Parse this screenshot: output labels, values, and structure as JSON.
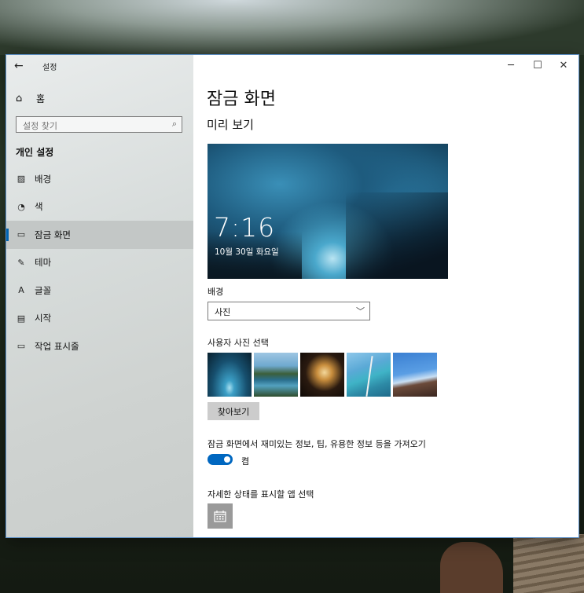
{
  "window": {
    "title": "설정",
    "back_icon": "←",
    "minimize_icon": "─",
    "maximize_icon": "☐",
    "close_icon": "✕"
  },
  "sidebar": {
    "home_icon": "⌂",
    "home_label": "홈",
    "search_placeholder": "설정 찾기",
    "search_icon": "⌕",
    "section_title": "개인 설정",
    "items": [
      {
        "icon": "🖼",
        "icon_name": "picture-icon",
        "label": "배경"
      },
      {
        "icon": "🎨",
        "icon_name": "palette-icon",
        "label": "색"
      },
      {
        "icon": "▭",
        "icon_name": "lock-screen-icon",
        "label": "잠금 화면",
        "active": true
      },
      {
        "icon": "✎",
        "icon_name": "theme-icon",
        "label": "테마"
      },
      {
        "icon": "A",
        "icon_name": "font-icon",
        "label": "글꼴"
      },
      {
        "icon": "▤",
        "icon_name": "start-icon",
        "label": "시작"
      },
      {
        "icon": "▭",
        "icon_name": "taskbar-icon",
        "label": "작업 표시줄"
      }
    ]
  },
  "main": {
    "title": "잠금 화면",
    "preview_heading": "미리 보기",
    "preview_time": "7:16",
    "preview_date": "10월 30일 화요일",
    "background_label": "배경",
    "background_value": "사진",
    "choose_photo_label": "사용자 사진 선택",
    "browse_label": "찾아보기",
    "fun_facts_label": "잠금 화면에서 재미있는 정보, 팁, 유용한 정보 등을 가져오기",
    "toggle_state_label": "켬",
    "toggle_on": true,
    "detailed_status_label": "자세한 상태를 표시할 앱 선택"
  },
  "colors": {
    "accent": "#0067c0",
    "sidebar_bg": "#d7dcdb",
    "active_item_bg": "#c3c7c6"
  }
}
